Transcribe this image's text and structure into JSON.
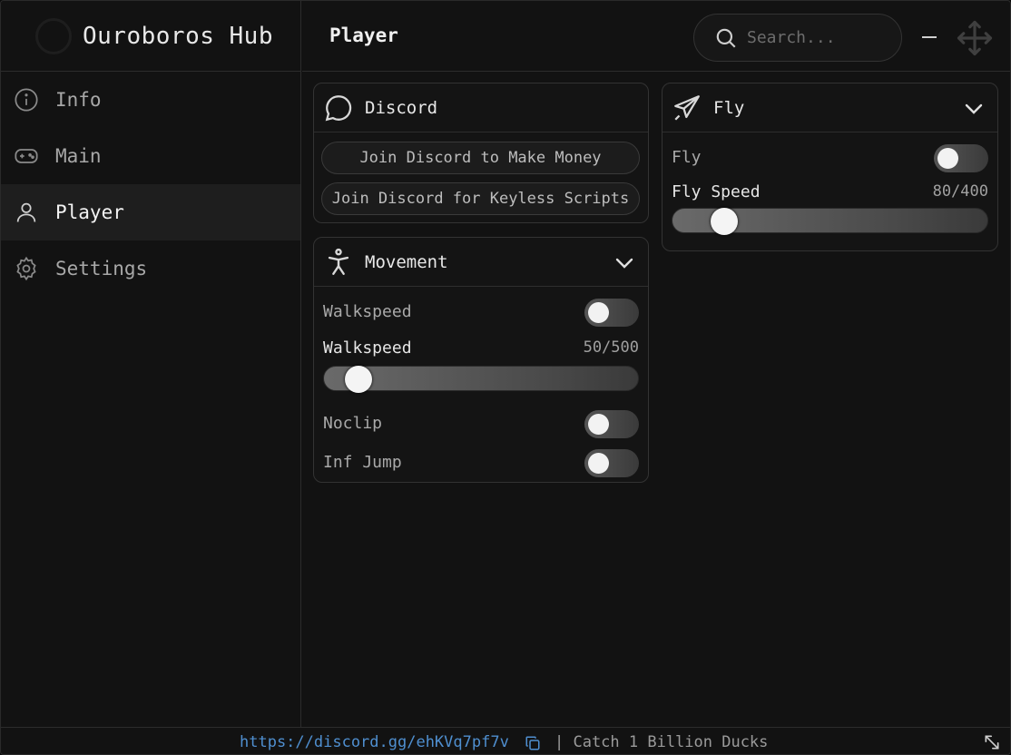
{
  "app": {
    "title": "Ouroboros Hub"
  },
  "sidebar": {
    "items": [
      {
        "label": "Info",
        "icon": "info-icon"
      },
      {
        "label": "Main",
        "icon": "gamepad-icon"
      },
      {
        "label": "Player",
        "icon": "user-icon"
      },
      {
        "label": "Settings",
        "icon": "gear-icon"
      }
    ],
    "active": "Player"
  },
  "header": {
    "title": "Player",
    "search_placeholder": "Search..."
  },
  "discord_panel": {
    "title": "Discord",
    "icon": "chat-bubble-icon",
    "buttons": [
      "Join Discord to Make Money",
      "Join Discord for Keyless Scripts"
    ]
  },
  "movement_panel": {
    "title": "Movement",
    "icon": "person-icon",
    "walkspeed_toggle_label": "Walkspeed",
    "walkspeed_slider_label": "Walkspeed",
    "walkspeed_value": "50/500",
    "walkspeed_fraction": 0.1,
    "noclip_label": "Noclip",
    "infjump_label": "Inf Jump"
  },
  "fly_panel": {
    "title": "Fly",
    "icon": "plane-icon",
    "fly_toggle_label": "Fly",
    "fly_speed_label": "Fly Speed",
    "fly_speed_value": "80/400",
    "fly_speed_fraction": 0.2
  },
  "footer": {
    "link": "https://discord.gg/ehKVq7pf7v",
    "note": "| Catch 1 Billion Ducks"
  },
  "colors": {
    "link": "#4f8fd0",
    "background": "#121212",
    "active_nav": "#1e1e1e"
  }
}
